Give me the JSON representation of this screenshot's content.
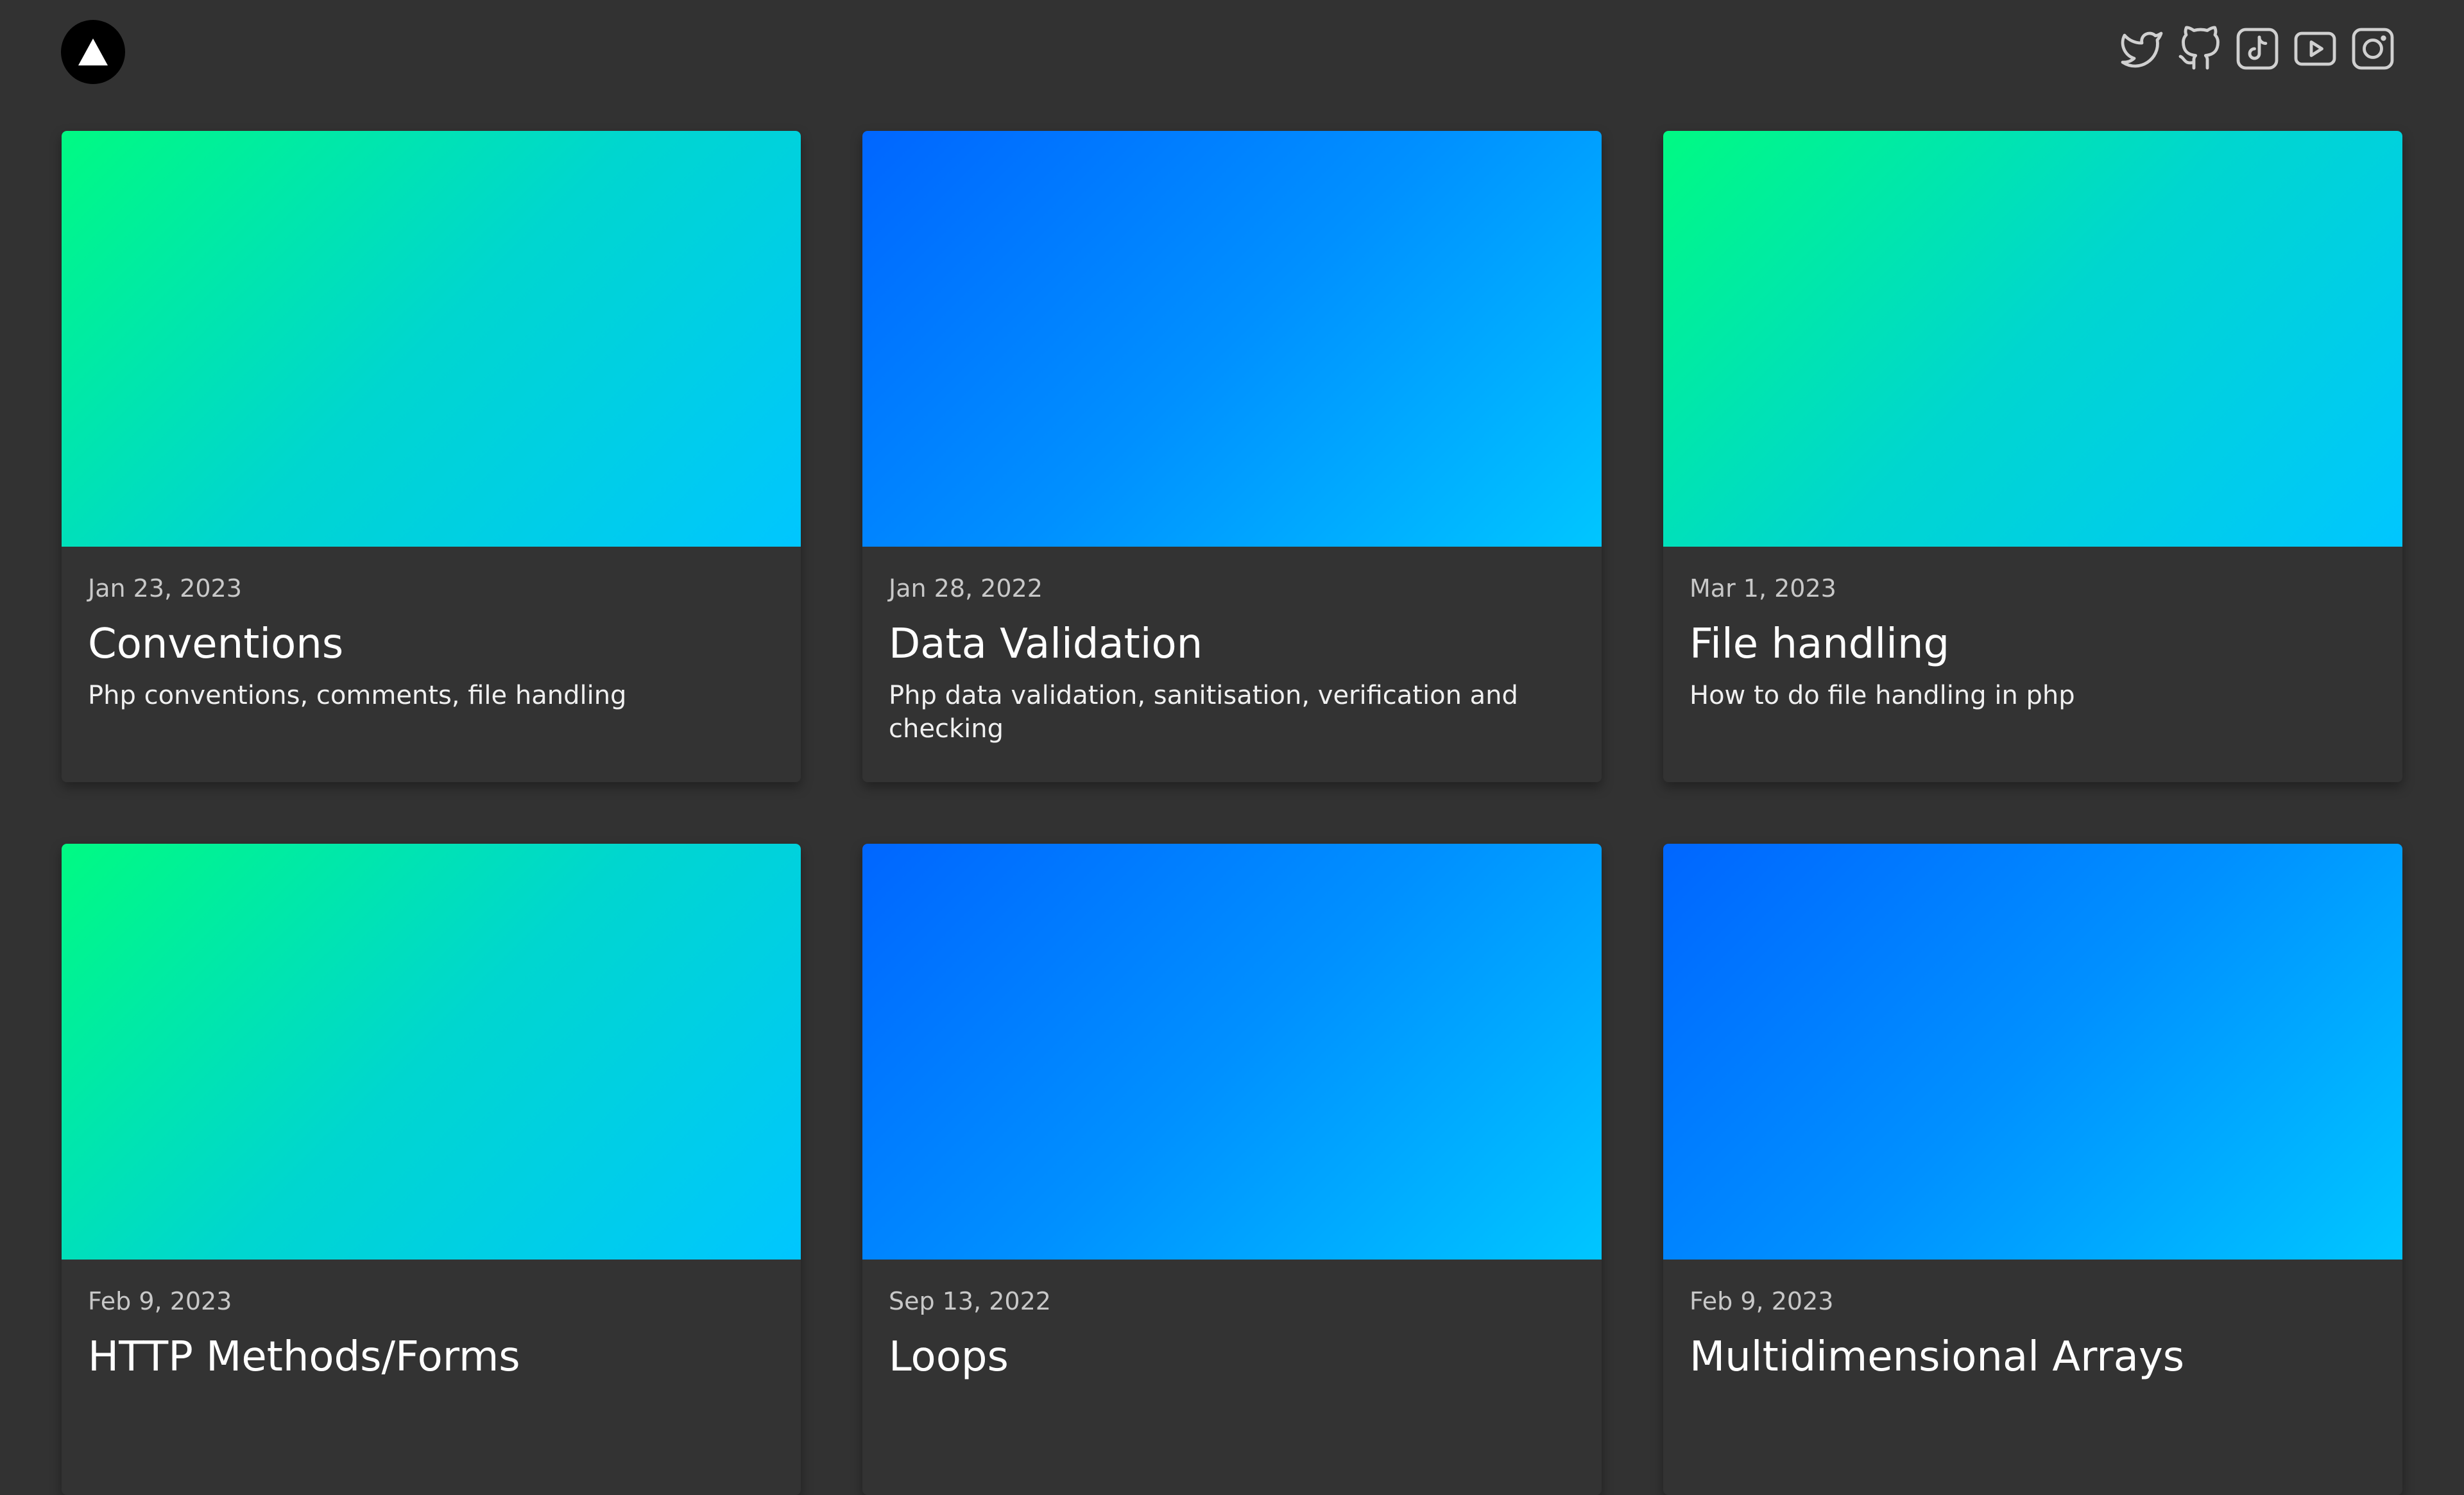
{
  "header": {
    "logo_icon": "triangle-logo-icon",
    "socials": [
      {
        "name": "twitter-icon"
      },
      {
        "name": "github-icon"
      },
      {
        "name": "tiktok-icon"
      },
      {
        "name": "youtube-icon"
      },
      {
        "name": "instagram-icon"
      }
    ]
  },
  "colors": {
    "background": "#323232",
    "card": "#333333",
    "gradient_green": [
      "#00fa83",
      "#00c6ff"
    ],
    "gradient_blue": [
      "#0066ff",
      "#00c6ff"
    ]
  },
  "posts": [
    {
      "date": "Jan 23, 2023",
      "title": "Conventions",
      "description": "Php conventions, comments, file handling",
      "thumb": "green"
    },
    {
      "date": "Jan 28, 2022",
      "title": "Data Validation",
      "description": "Php data validation, sanitisation, verification and checking",
      "thumb": "blue"
    },
    {
      "date": "Mar 1, 2023",
      "title": "File handling",
      "description": "How to do file handling in php",
      "thumb": "green"
    },
    {
      "date": "Feb 9, 2023",
      "title": "HTTP Methods/Forms",
      "description": "",
      "thumb": "green"
    },
    {
      "date": "Sep 13, 2022",
      "title": "Loops",
      "description": "",
      "thumb": "blue"
    },
    {
      "date": "Feb 9, 2023",
      "title": "Multidimensional Arrays",
      "description": "",
      "thumb": "blue"
    }
  ]
}
